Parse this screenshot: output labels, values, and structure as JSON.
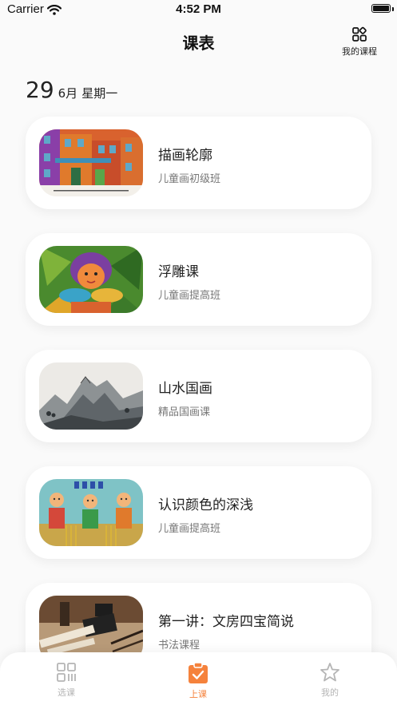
{
  "status_bar": {
    "carrier": "Carrier",
    "time": "4:52 PM"
  },
  "header": {
    "title": "课表",
    "my_courses_label": "我的课程"
  },
  "date": {
    "day": "29",
    "month": "6月",
    "weekday": "星期一"
  },
  "courses": [
    {
      "title": "描画轮廓",
      "subtitle": "儿童画初级班"
    },
    {
      "title": "浮雕课",
      "subtitle": "儿童画提高班"
    },
    {
      "title": "山水国画",
      "subtitle": "精品国画课"
    },
    {
      "title": "认识颜色的深浅",
      "subtitle": "儿童画提高班"
    },
    {
      "title": "第一讲：文房四宝简说",
      "subtitle": "书法课程"
    }
  ],
  "tabs": [
    {
      "label": "选课",
      "icon": "grid-qr-icon",
      "active": false
    },
    {
      "label": "上课",
      "icon": "clipboard-check-icon",
      "active": true
    },
    {
      "label": "我的",
      "icon": "star-icon",
      "active": false
    }
  ],
  "colors": {
    "accent": "#f5823c",
    "inactive": "#b5b5b5",
    "card_bg": "#ffffff",
    "page_bg": "#fafafa"
  }
}
